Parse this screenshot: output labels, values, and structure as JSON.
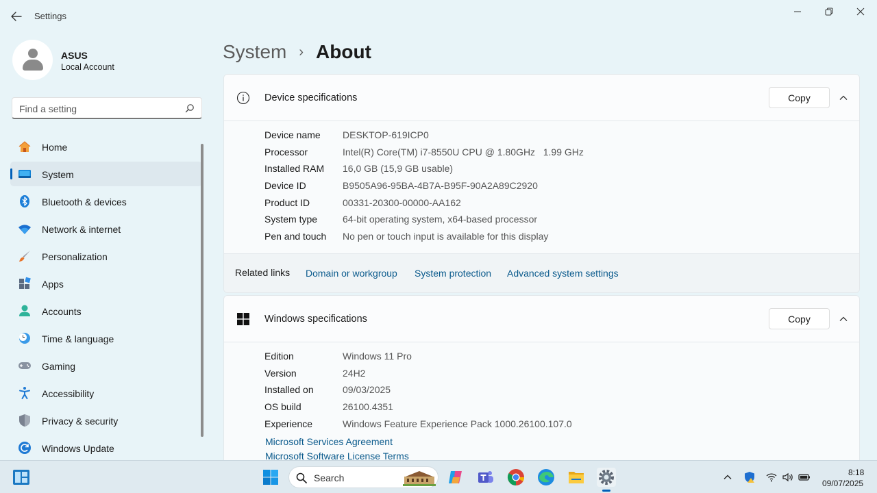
{
  "window": {
    "app_title": "Settings"
  },
  "profile": {
    "name": "ASUS",
    "account_type": "Local Account"
  },
  "search": {
    "placeholder": "Find a setting"
  },
  "sidebar": {
    "items": [
      {
        "label": "Home",
        "icon": "home-icon",
        "active": false
      },
      {
        "label": "System",
        "icon": "system-icon",
        "active": true
      },
      {
        "label": "Bluetooth & devices",
        "icon": "bluetooth-icon",
        "active": false
      },
      {
        "label": "Network & internet",
        "icon": "wifi-icon",
        "active": false
      },
      {
        "label": "Personalization",
        "icon": "brush-icon",
        "active": false
      },
      {
        "label": "Apps",
        "icon": "apps-icon",
        "active": false
      },
      {
        "label": "Accounts",
        "icon": "accounts-icon",
        "active": false
      },
      {
        "label": "Time & language",
        "icon": "clock-globe-icon",
        "active": false
      },
      {
        "label": "Gaming",
        "icon": "gamepad-icon",
        "active": false
      },
      {
        "label": "Accessibility",
        "icon": "accessibility-icon",
        "active": false
      },
      {
        "label": "Privacy & security",
        "icon": "shield-icon",
        "active": false
      },
      {
        "label": "Windows Update",
        "icon": "update-icon",
        "active": false
      }
    ]
  },
  "breadcrumb": {
    "parent": "System",
    "separator": "›",
    "current": "About"
  },
  "device_specs": {
    "title": "Device specifications",
    "copy_label": "Copy",
    "rows": [
      {
        "label": "Device name",
        "value": "DESKTOP-619ICP0"
      },
      {
        "label": "Processor",
        "value": "Intel(R) Core(TM) i7-8550U CPU @ 1.80GHz   1.99 GHz"
      },
      {
        "label": "Installed RAM",
        "value": "16,0 GB (15,9 GB usable)"
      },
      {
        "label": "Device ID",
        "value": "B9505A96-95BA-4B7A-B95F-90A2A89C2920"
      },
      {
        "label": "Product ID",
        "value": "00331-20300-00000-AA162"
      },
      {
        "label": "System type",
        "value": "64-bit operating system, x64-based processor"
      },
      {
        "label": "Pen and touch",
        "value": "No pen or touch input is available for this display"
      }
    ]
  },
  "related_links": {
    "title": "Related links",
    "links": [
      "Domain or workgroup",
      "System protection",
      "Advanced system settings"
    ]
  },
  "windows_specs": {
    "title": "Windows specifications",
    "copy_label": "Copy",
    "rows": [
      {
        "label": "Edition",
        "value": "Windows 11 Pro"
      },
      {
        "label": "Version",
        "value": "24H2"
      },
      {
        "label": "Installed on",
        "value": "09/03/2025"
      },
      {
        "label": "OS build",
        "value": "26100.4351"
      },
      {
        "label": "Experience",
        "value": "Windows Feature Experience Pack 1000.26100.107.0"
      }
    ],
    "links": [
      "Microsoft Services Agreement",
      "Microsoft Software License Terms"
    ]
  },
  "taskbar": {
    "search_label": "Search",
    "apps": [
      "copilot-icon",
      "teams-icon",
      "chrome-icon",
      "edge-icon",
      "file-explorer-icon",
      "settings-icon"
    ],
    "time": "8:18",
    "date": "09/07/2025"
  },
  "colors": {
    "accent": "#005fb8",
    "link": "#0a5a8c",
    "background": "#e8f4f8"
  }
}
